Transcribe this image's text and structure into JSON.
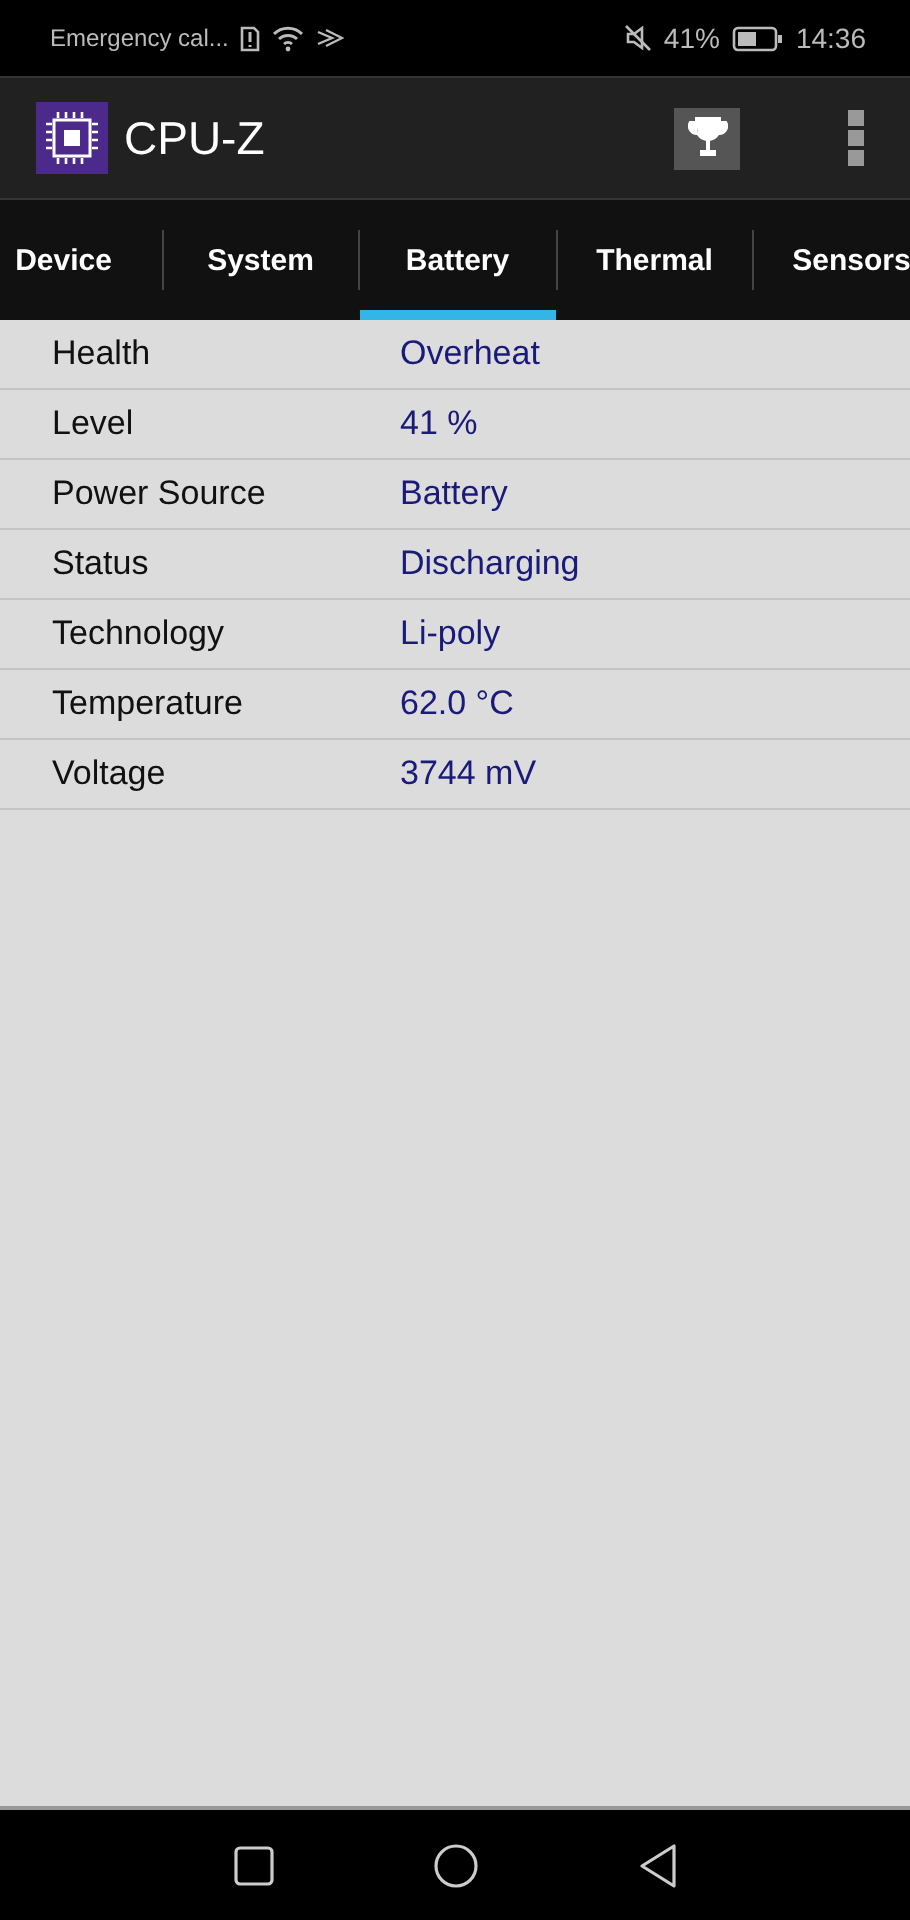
{
  "status_bar": {
    "carrier": "Emergency cal...",
    "battery": "41%",
    "time": "14:36"
  },
  "app_bar": {
    "title": "CPU-Z"
  },
  "tabs": [
    {
      "label": "Device",
      "selected": false
    },
    {
      "label": "System",
      "selected": false
    },
    {
      "label": "Battery",
      "selected": true
    },
    {
      "label": "Thermal",
      "selected": false
    },
    {
      "label": "Sensors",
      "selected": false
    }
  ],
  "rows": [
    {
      "label": "Health",
      "value": "Overheat"
    },
    {
      "label": "Level",
      "value": "41 %"
    },
    {
      "label": "Power Source",
      "value": "Battery"
    },
    {
      "label": "Status",
      "value": "Discharging"
    },
    {
      "label": "Technology",
      "value": "Li-poly"
    },
    {
      "label": "Temperature",
      "value": "62.0 °C"
    },
    {
      "label": "Voltage",
      "value": "3744 mV"
    }
  ]
}
